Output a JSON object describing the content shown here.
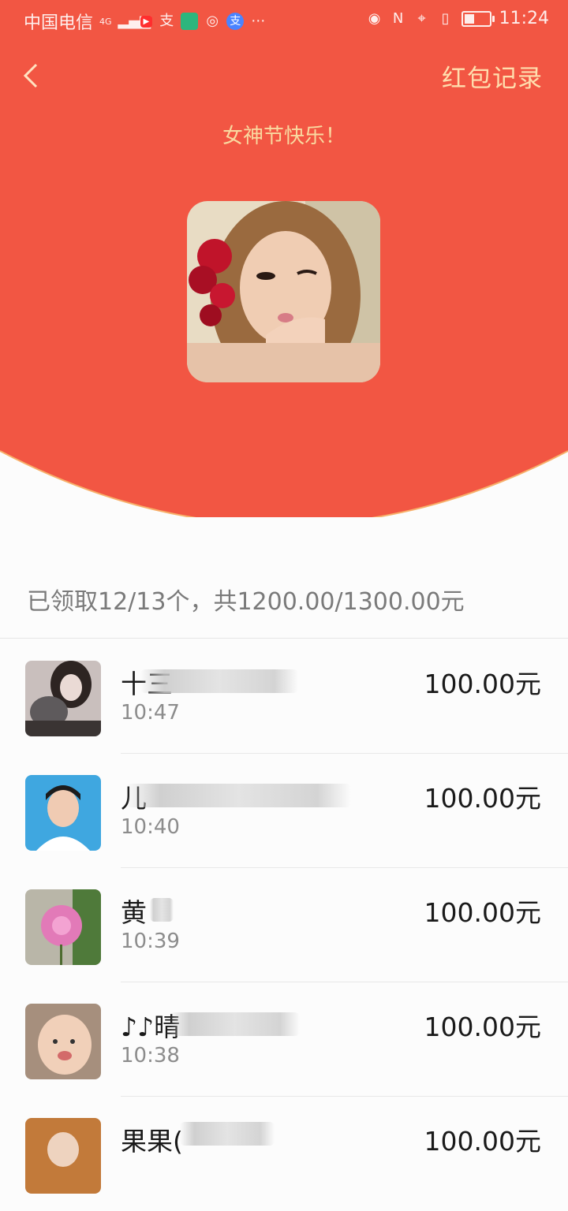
{
  "status_bar": {
    "carrier": "中国电信",
    "network": "4G",
    "time": "11:24"
  },
  "header": {
    "records_label": "红包记录",
    "greeting": "女神节快乐！"
  },
  "summary": "已领取12/13个，共1200.00/1300.00元",
  "recipients": [
    {
      "name": "十三",
      "time": "10:47",
      "amount": "100.00元"
    },
    {
      "name": "儿",
      "time": "10:40",
      "amount": "100.00元"
    },
    {
      "name": "黄",
      "time": "10:39",
      "amount": "100.00元"
    },
    {
      "name": "♪♪晴",
      "time": "10:38",
      "amount": "100.00元"
    },
    {
      "name": "果果(",
      "time": "",
      "amount": "100.00元"
    }
  ],
  "colors": {
    "accent_red": "#f25643",
    "gold_text": "#f9d9a0"
  }
}
